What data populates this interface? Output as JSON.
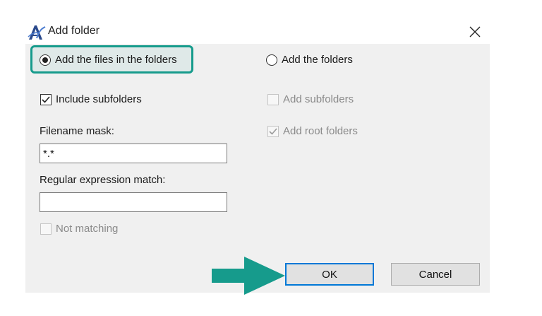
{
  "window": {
    "title": "Add folder",
    "icon": "app-logo-icon",
    "close_icon": "close-icon"
  },
  "options": {
    "add_files_in_folders": {
      "label": "Add the files in the folders",
      "selected": true
    },
    "add_folders": {
      "label": "Add the folders",
      "selected": false
    },
    "include_subfolders": {
      "label": "Include subfolders",
      "checked": true,
      "enabled": true
    },
    "add_subfolders": {
      "label": "Add subfolders",
      "checked": false,
      "enabled": false
    },
    "add_root_folders": {
      "label": "Add root folders",
      "checked": true,
      "enabled": false
    },
    "not_matching": {
      "label": "Not matching",
      "checked": false,
      "enabled": false
    }
  },
  "filename_mask": {
    "label": "Filename mask:",
    "value": "*.*"
  },
  "regex_match": {
    "label": "Regular expression match:",
    "value": ""
  },
  "buttons": {
    "ok": "OK",
    "cancel": "Cancel"
  },
  "annotation": {
    "highlight_color": "#169b8c",
    "arrow_color": "#169b8c"
  }
}
